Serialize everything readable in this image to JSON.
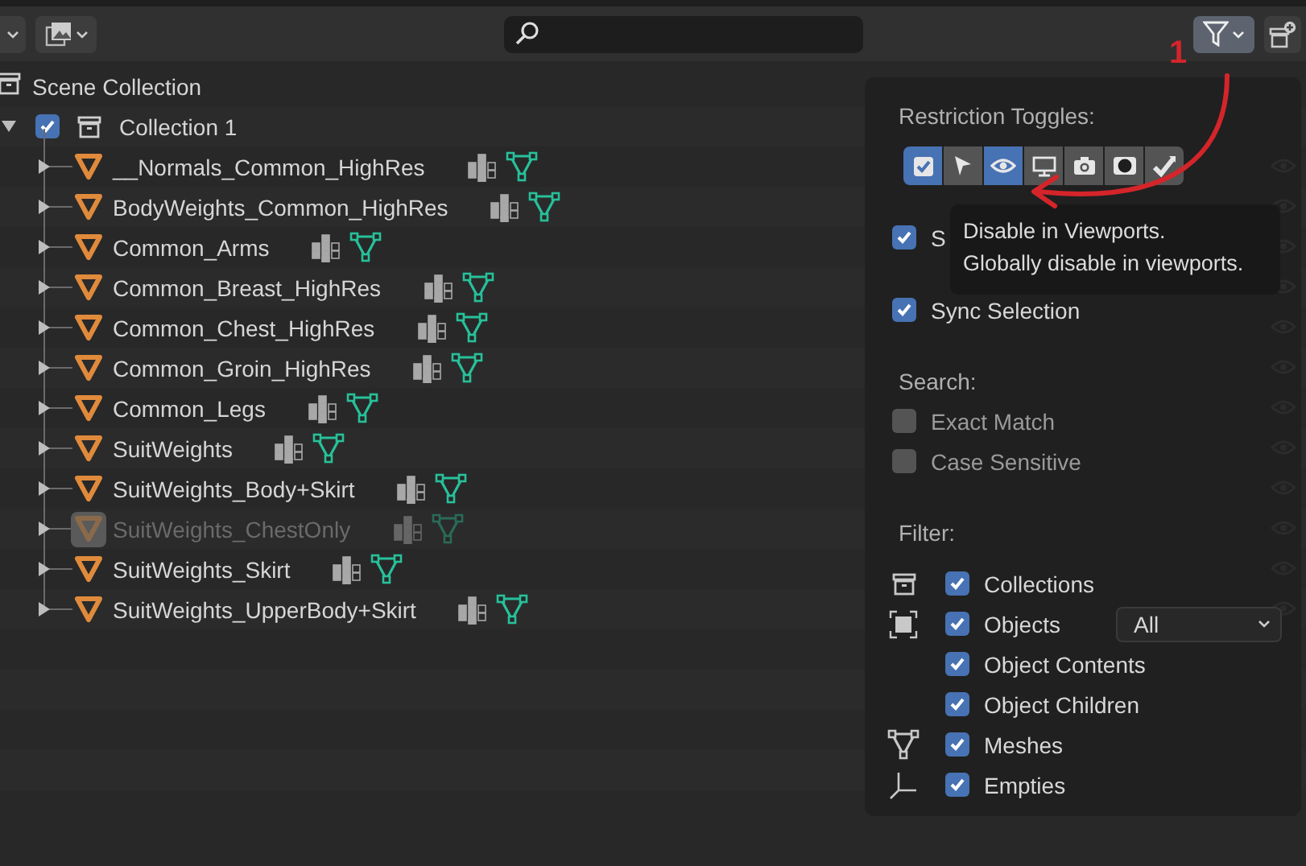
{
  "header": {
    "annotation": "1"
  },
  "outliner": {
    "root": {
      "label": "Scene Collection",
      "children": [
        {
          "label": "Collection 1",
          "checked": true,
          "expanded": true,
          "children": [
            {
              "label": "__Normals_Common_HighRes",
              "disabled": false
            },
            {
              "label": "BodyWeights_Common_HighRes",
              "disabled": false
            },
            {
              "label": "Common_Arms",
              "disabled": false
            },
            {
              "label": "Common_Breast_HighRes",
              "disabled": false
            },
            {
              "label": "Common_Chest_HighRes",
              "disabled": false
            },
            {
              "label": "Common_Groin_HighRes",
              "disabled": false
            },
            {
              "label": "Common_Legs",
              "disabled": false
            },
            {
              "label": "SuitWeights",
              "disabled": false
            },
            {
              "label": "SuitWeights_Body+Skirt",
              "disabled": false
            },
            {
              "label": "SuitWeights_ChestOnly",
              "disabled": true
            },
            {
              "label": "SuitWeights_Skirt",
              "disabled": false
            },
            {
              "label": "SuitWeights_UpperBody+Skirt",
              "disabled": false
            }
          ]
        }
      ]
    }
  },
  "filter_popup": {
    "restriction_title": "Restriction Toggles:",
    "toggles": [
      {
        "kind": "checkbox",
        "selected": true
      },
      {
        "kind": "cursor",
        "selected": false
      },
      {
        "kind": "eye",
        "selected": true
      },
      {
        "kind": "monitor",
        "selected": false
      },
      {
        "kind": "camera",
        "selected": false
      },
      {
        "kind": "holdout",
        "selected": false
      },
      {
        "kind": "indirect",
        "selected": false
      }
    ],
    "options": [
      {
        "label": "S",
        "checked": true
      },
      {
        "label": "Sync Selection",
        "checked": true
      }
    ],
    "search_title": "Search:",
    "search_options": [
      {
        "label": "Exact Match",
        "checked": false
      },
      {
        "label": "Case Sensitive",
        "checked": false
      }
    ],
    "filter_title": "Filter:",
    "filter_options": [
      {
        "label": "Collections",
        "checked": true,
        "kind": "collection"
      },
      {
        "label": "Objects",
        "checked": true,
        "kind": "object",
        "dropdown": "All"
      },
      {
        "label": "Object Contents",
        "checked": true
      },
      {
        "label": "Object Children",
        "checked": true
      },
      {
        "label": "Meshes",
        "checked": true,
        "kind": "mesh"
      },
      {
        "label": "Empties",
        "checked": true,
        "kind": "empty"
      }
    ]
  },
  "tooltip": {
    "lines": [
      "Disable in Viewports.",
      "Globally disable in viewports."
    ]
  }
}
